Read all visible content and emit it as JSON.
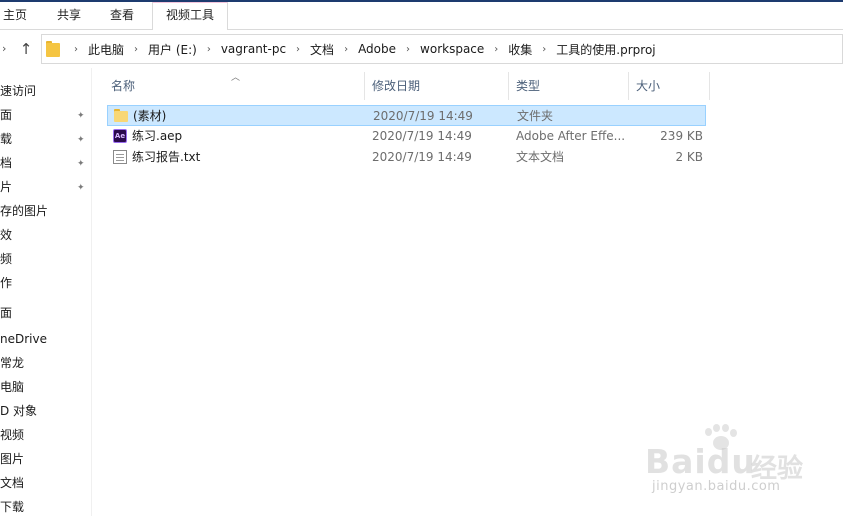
{
  "ribbon": {
    "tabs": [
      "主页",
      "共享",
      "查看"
    ],
    "contextual_tab": "视频工具"
  },
  "address": {
    "crumbs": [
      "此电脑",
      "用户 (E:)",
      "vagrant-pc",
      "文档",
      "Adobe",
      "workspace",
      "收集",
      "工具的使用.prproj"
    ]
  },
  "nav": {
    "items": [
      {
        "label": "速访问",
        "pinned": false
      },
      {
        "label": "面",
        "pinned": true
      },
      {
        "label": "载",
        "pinned": true
      },
      {
        "label": "档",
        "pinned": true
      },
      {
        "label": "片",
        "pinned": true
      },
      {
        "label": "存的图片",
        "pinned": false
      },
      {
        "label": "效",
        "pinned": false
      },
      {
        "label": "频",
        "pinned": false
      },
      {
        "label": "作",
        "pinned": false
      },
      {
        "label": "面",
        "pinned": false
      },
      {
        "label": "neDrive",
        "pinned": false
      },
      {
        "label": "常龙",
        "pinned": false
      },
      {
        "label": "电脑",
        "pinned": false
      },
      {
        "label": "D 对象",
        "pinned": false
      },
      {
        "label": "视频",
        "pinned": false
      },
      {
        "label": "图片",
        "pinned": false
      },
      {
        "label": "文档",
        "pinned": false
      },
      {
        "label": "下载",
        "pinned": false
      }
    ]
  },
  "columns": {
    "name": "名称",
    "date": "修改日期",
    "type": "类型",
    "size": "大小"
  },
  "files": [
    {
      "name": "(素材)",
      "date": "2020/7/19 14:49",
      "type": "文件夹",
      "size": "",
      "icon": "folder-icon",
      "selected": true
    },
    {
      "name": "练习.aep",
      "date": "2020/7/19 14:49",
      "type": "Adobe After Effe...",
      "size": "239 KB",
      "icon": "after-effects-file-icon",
      "selected": false
    },
    {
      "name": "练习报告.txt",
      "date": "2020/7/19 14:49",
      "type": "文本文档",
      "size": "2 KB",
      "icon": "text-file-icon",
      "selected": false
    }
  ],
  "icons": {
    "ae_label": "Ae",
    "up_arrow": "↑",
    "chevron": "›",
    "pin": "📌"
  },
  "watermark": {
    "brand": "Baidu",
    "brand_cn": "经验",
    "url": "jingyan.baidu.com"
  },
  "colors": {
    "selection_bg": "#cce8ff",
    "selection_border": "#99d1ff",
    "header_text": "#4c607a"
  }
}
